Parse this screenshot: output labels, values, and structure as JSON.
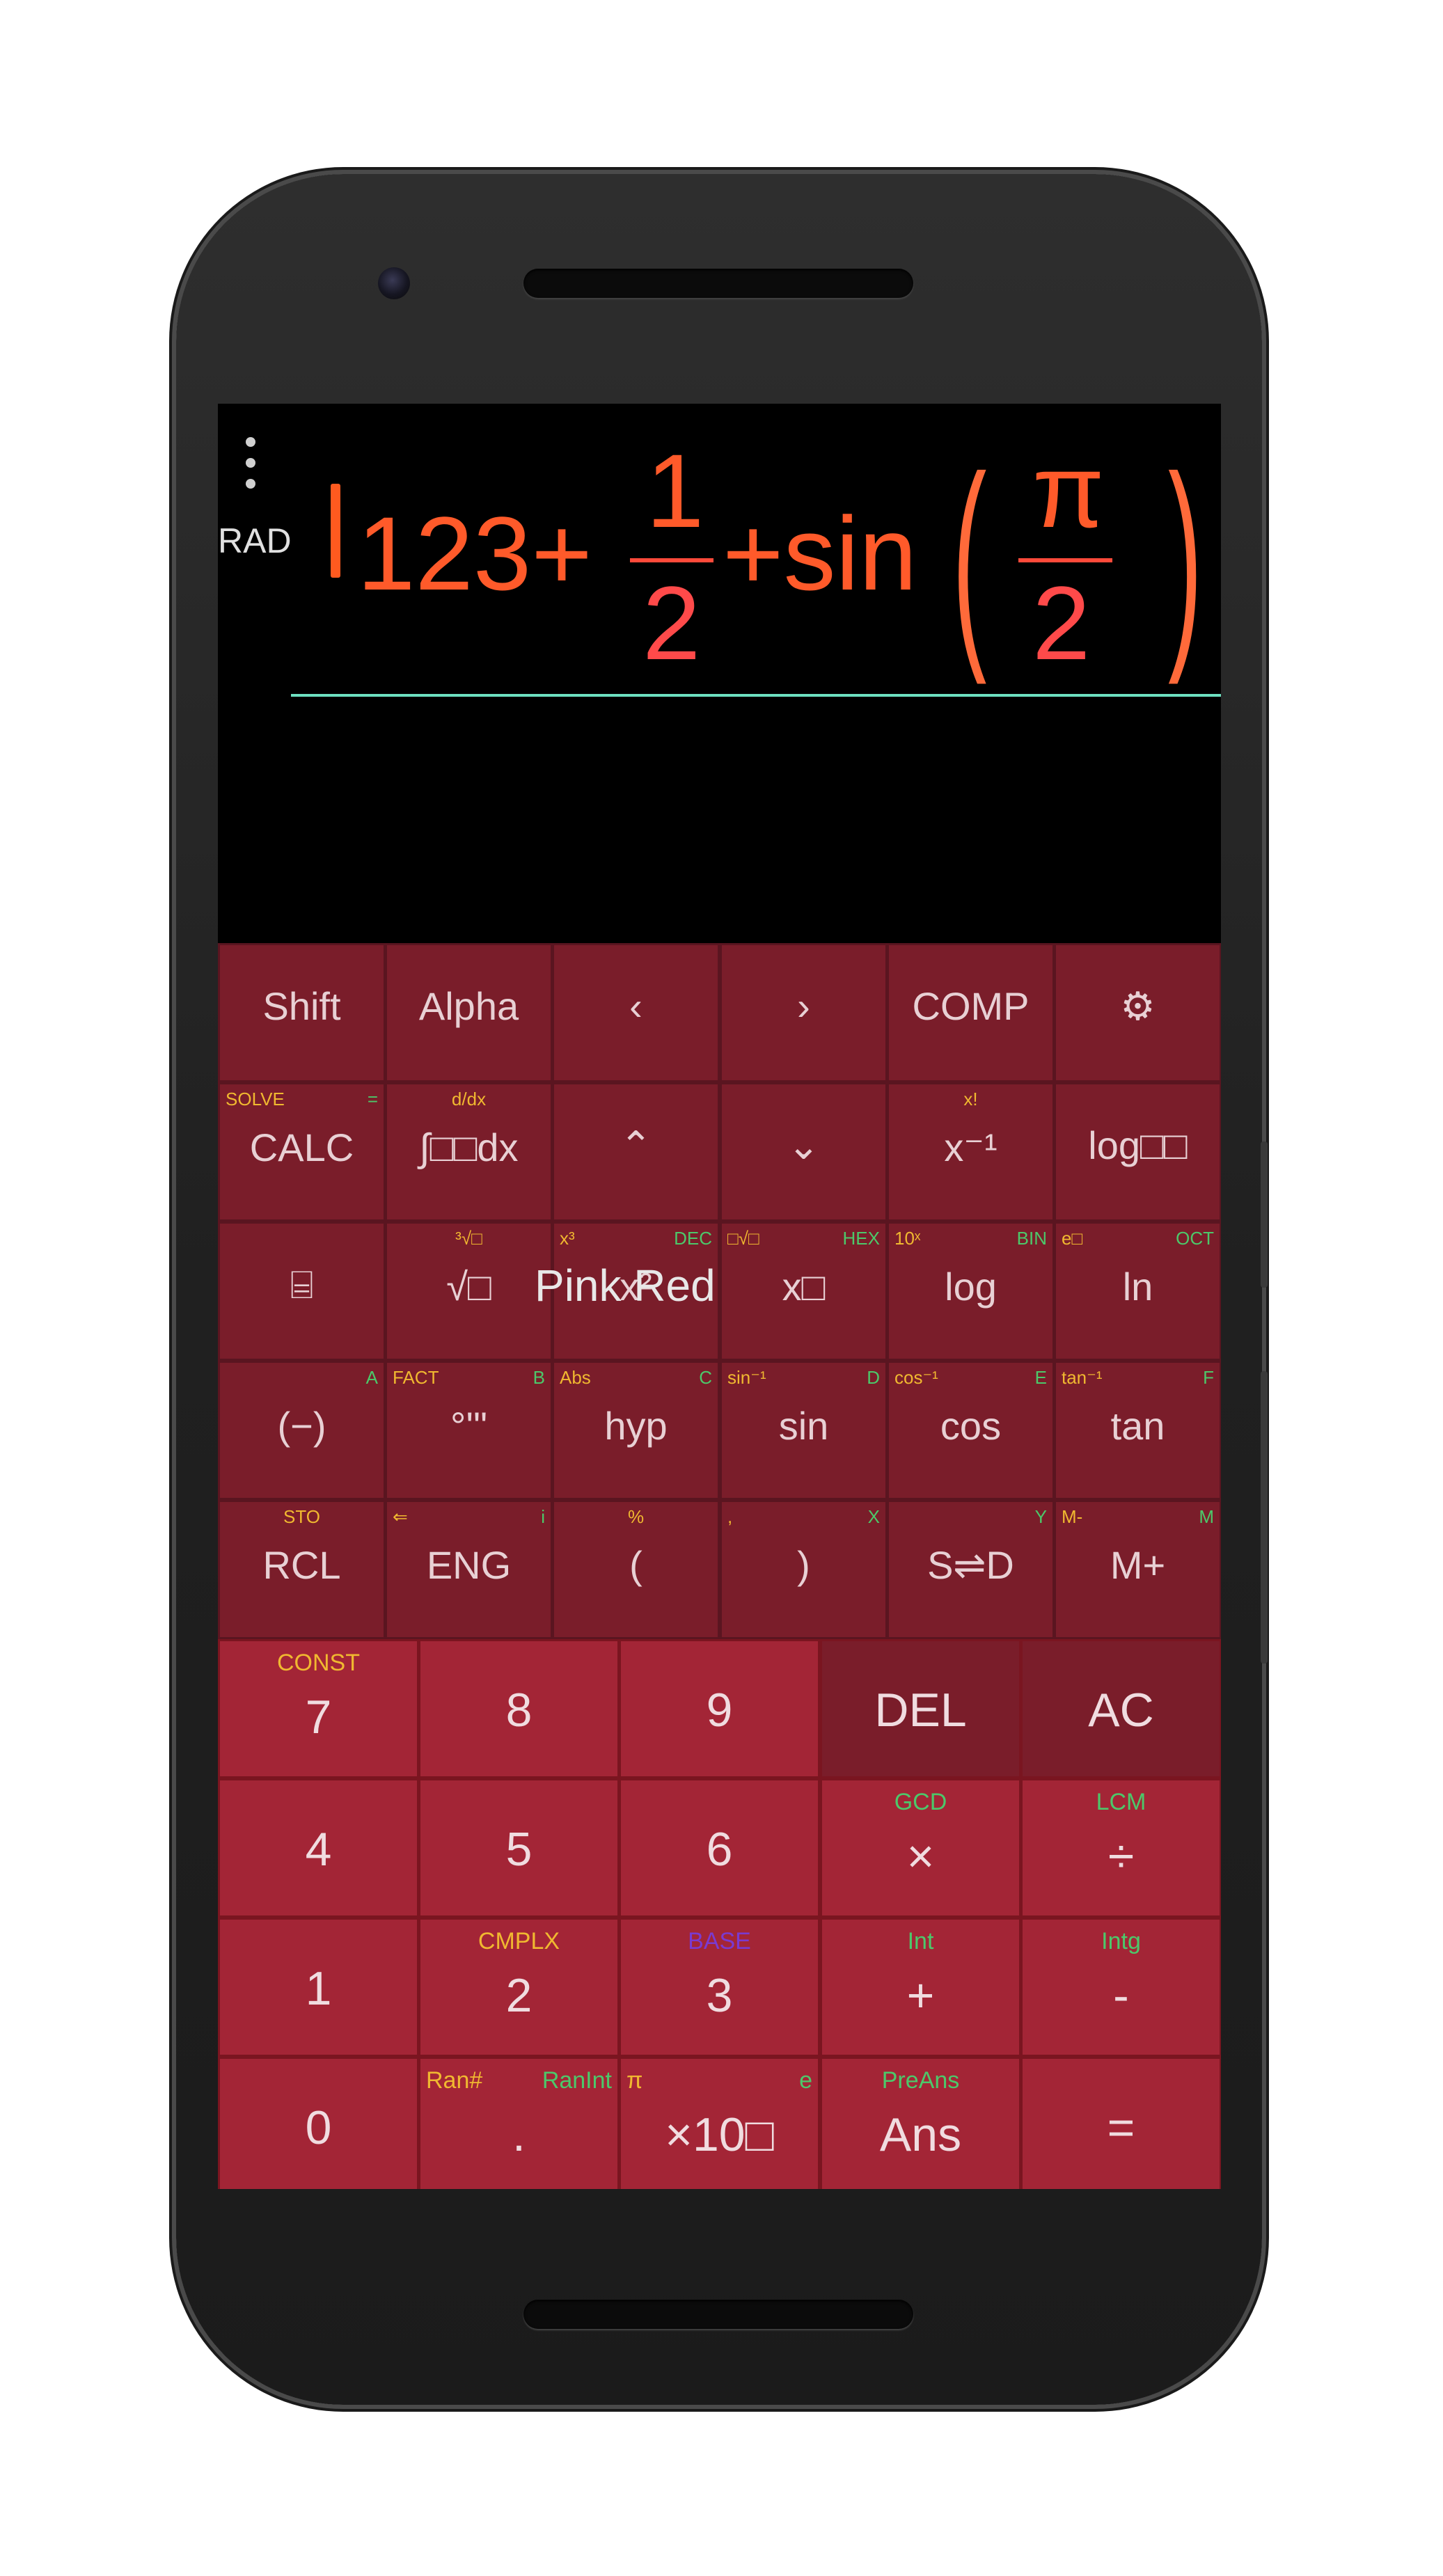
{
  "display": {
    "mode": "RAD",
    "expr_a": "123+",
    "frac1_num": "1",
    "frac1_den": "2",
    "expr_b": "+sin",
    "frac2_num": "π",
    "frac2_den": "2",
    "paren_open": "(",
    "paren_close": ")"
  },
  "watermark": "Pink Red",
  "colors": {
    "key_bg": "#7a1d2a",
    "num_key_bg": "#a32536",
    "expr": "#ff5a2a",
    "divider": "#6ee0c0"
  },
  "row1": [
    {
      "main": "Shift",
      "cls": "y"
    },
    {
      "main": "Alpha",
      "cls": "g"
    },
    {
      "main": "‹",
      "cls": "w"
    },
    {
      "main": "›",
      "cls": "w"
    },
    {
      "main": "COMP",
      "cls": "w"
    },
    {
      "main": "⚙",
      "cls": "w",
      "icon": "gear-icon"
    }
  ],
  "row2": [
    {
      "main": "CALC",
      "l": "SOLVE",
      "r": "="
    },
    {
      "main": "∫□□dx",
      "c": "d/dx"
    },
    {
      "main": "⌃",
      "icon": "chevron-up-icon"
    },
    {
      "main": "⌄",
      "icon": "chevron-down-icon"
    },
    {
      "main": "x⁻¹",
      "c": "x!"
    },
    {
      "main": "log□□"
    }
  ],
  "row3": [
    {
      "main": "⌸",
      "icon": "fraction-icon"
    },
    {
      "main": "√□",
      "c": "³√□"
    },
    {
      "main": "x²",
      "l": "x³",
      "r": "DEC"
    },
    {
      "main": "x□",
      "l": "□√□",
      "r": "HEX"
    },
    {
      "main": "log",
      "l": "10ˣ",
      "r": "BIN"
    },
    {
      "main": "ln",
      "l": "e□",
      "r": "OCT"
    }
  ],
  "row4": [
    {
      "main": "(−)",
      "r": "A"
    },
    {
      "main": "°'\"",
      "l": "FACT",
      "r": "B"
    },
    {
      "main": "hyp",
      "l": "Abs",
      "r": "C"
    },
    {
      "main": "sin",
      "l": "sin⁻¹",
      "r": "D"
    },
    {
      "main": "cos",
      "l": "cos⁻¹",
      "r": "E"
    },
    {
      "main": "tan",
      "l": "tan⁻¹",
      "r": "F"
    }
  ],
  "row5": [
    {
      "main": "RCL",
      "c": "STO"
    },
    {
      "main": "ENG",
      "l": "⇐",
      "r": "i"
    },
    {
      "main": "(",
      "c": "%"
    },
    {
      "main": ")",
      "l": ",",
      "r": "X"
    },
    {
      "main": "S⇌D",
      "r": "Y"
    },
    {
      "main": "M+",
      "l": "M-",
      "r": "M"
    }
  ],
  "num_rows": [
    [
      {
        "main": "7",
        "c": "CONST",
        "cc": "y"
      },
      {
        "main": "8"
      },
      {
        "main": "9"
      },
      {
        "main": "DEL",
        "dark": true
      },
      {
        "main": "AC",
        "dark": true
      }
    ],
    [
      {
        "main": "4"
      },
      {
        "main": "5"
      },
      {
        "main": "6"
      },
      {
        "main": "×",
        "c": "GCD",
        "cc": "g"
      },
      {
        "main": "÷",
        "c": "LCM",
        "cc": "g"
      }
    ],
    [
      {
        "main": "1"
      },
      {
        "main": "2",
        "c": "CMPLX",
        "cc": "y"
      },
      {
        "main": "3",
        "c": "BASE",
        "cc": "p"
      },
      {
        "main": "+",
        "c": "Int",
        "cc": "g"
      },
      {
        "main": "-",
        "c": "Intg",
        "cc": "g"
      }
    ],
    [
      {
        "main": "0"
      },
      {
        "main": ".",
        "l": "Ran#",
        "lc": "y",
        "r": "RanInt",
        "rc": "g"
      },
      {
        "main": "×10□",
        "l": "π",
        "lc": "y",
        "r": "e",
        "rc": "g"
      },
      {
        "main": "Ans",
        "c": "PreAns",
        "cc": "g"
      },
      {
        "main": "="
      }
    ]
  ]
}
